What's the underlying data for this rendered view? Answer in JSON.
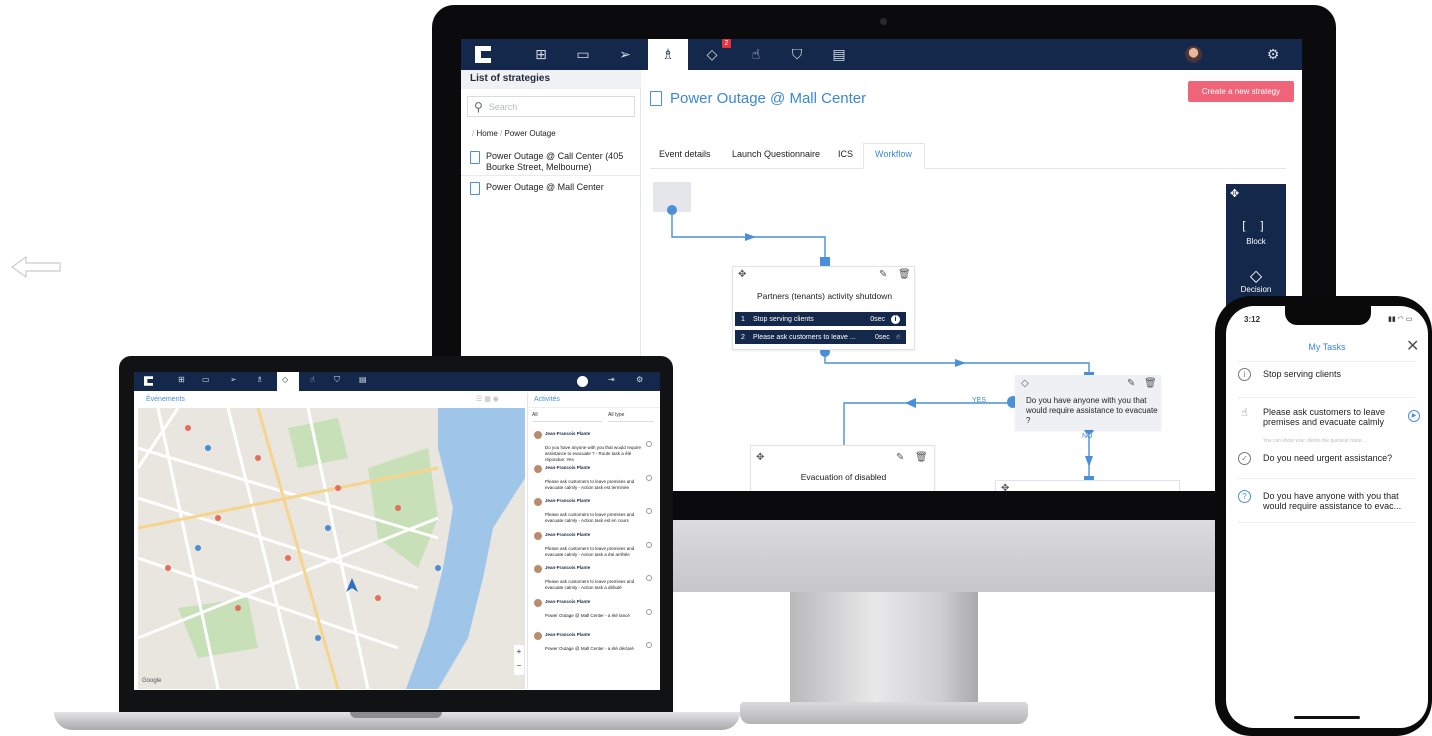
{
  "desktop": {
    "sidebar": {
      "header": "List of strategies",
      "search_placeholder": "Search",
      "breadcrumb_home": "Home",
      "breadcrumb_sep": "/",
      "breadcrumb_current": "Power Outage",
      "items": [
        {
          "label_line1": "Power Outage @ Call Center (405",
          "label_line2": "Bourke Street, Melbourne)"
        },
        {
          "label_line1": "Power Outage @ Mall Center",
          "label_line2": ""
        }
      ]
    },
    "nav": {
      "badge_count": "2"
    },
    "page_title": "Power Outage @ Mall Center",
    "create_button": "Create a new strategy",
    "tabs": [
      "Event details",
      "Launch Questionnaire",
      "ICS",
      "Workflow"
    ],
    "active_tab_index": 3,
    "toolbox": {
      "block_label": "Block",
      "decision_label": "Decision"
    },
    "workflow": {
      "node1_title": "Partners (tenants) activity shutdown",
      "node1_rows": [
        {
          "num": "1",
          "text": "Stop serving clients",
          "time": "0sec"
        },
        {
          "num": "2",
          "text": "Please ask customers to leave ...",
          "time": "0sec"
        }
      ],
      "decision_text": "Do you have anyone with you that would require assistance to evacuate ?",
      "yes_label": "YES",
      "no_label": "NO",
      "node2_title": "Evacuation of disabled"
    }
  },
  "laptop": {
    "map_header": "Événements",
    "activities_header": "Activités",
    "filter_all": "All",
    "filter_type": "All type",
    "map_brand": "Google",
    "activities": [
      {
        "name": "Jean-Francois Plante",
        "text": "Do you have anyone with you that would require assistance to evacuate ? - Route task a été répondue: Yes"
      },
      {
        "name": "Jean-Francois Plante",
        "text": "Please ask customers to leave premises and evacuate calmly - Action task est terminée"
      },
      {
        "name": "Jean-Francois Plante",
        "text": "Please ask customers to leave premises and evacuate calmly - Action task est en cours"
      },
      {
        "name": "Jean-Francois Plante",
        "text": "Please ask customers to leave premises and evacuate calmly - Action task a été arrêtée"
      },
      {
        "name": "Jean-Francois Plante",
        "text": "Please ask customers to leave premises and evacuate calmly - Action task a débuté"
      },
      {
        "name": "Jean-Francois Plante",
        "text": "Power Outage @ Mall Center - a été lancé"
      },
      {
        "name": "Jean-Francois Plante",
        "text": "Power Outage @ Mall Center - a été déclaré"
      }
    ]
  },
  "phone": {
    "time": "3:12",
    "title": "My Tasks",
    "tasks": [
      {
        "text": "Stop serving clients",
        "icon": "info-icon"
      },
      {
        "text": "Please ask customers to leave premises and evacuate calmly",
        "icon": "hand-icon",
        "hint": "You can show your clients the quickest route..."
      },
      {
        "text": "Do you need urgent assistance?",
        "icon": "check-icon"
      },
      {
        "text": "Do you have anyone with you that would require assistance to evac...",
        "icon": "question-icon"
      }
    ]
  },
  "colors": {
    "navy": "#14284b",
    "accent_blue": "#3b87d6",
    "create_pink": "#f0647a",
    "badge_red": "#e6333f"
  }
}
